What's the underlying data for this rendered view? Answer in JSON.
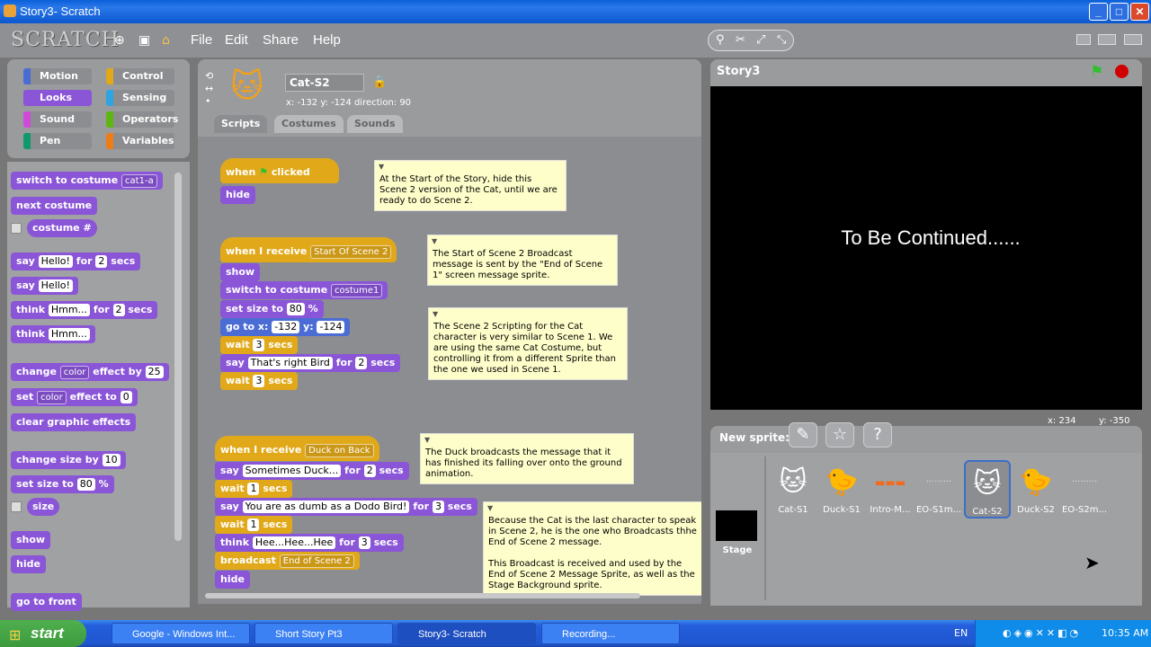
{
  "window": {
    "title": "Story3- Scratch",
    "min": "_",
    "max": "□",
    "close": "✕"
  },
  "menu": {
    "logo": "SCRATCH",
    "items": [
      "File",
      "Edit",
      "Share",
      "Help"
    ]
  },
  "categories": [
    {
      "label": "Motion",
      "color": "#4a6cd4"
    },
    {
      "label": "Control",
      "color": "#e1a91a"
    },
    {
      "label": "Looks",
      "color": "#8a55d7"
    },
    {
      "label": "Sensing",
      "color": "#2ca5e2"
    },
    {
      "label": "Sound",
      "color": "#cf4ad9"
    },
    {
      "label": "Operators",
      "color": "#5cb712"
    },
    {
      "label": "Pen",
      "color": "#0e9a6c"
    },
    {
      "label": "Variables",
      "color": "#ee7d16"
    }
  ],
  "palette": {
    "switch": "switch to costume",
    "switch_dd": "cat1-a",
    "next": "next costume",
    "costume_num": "costume #",
    "say_for": "say",
    "say_for_val": "Hello!",
    "for": "for",
    "secs": "secs",
    "say_for_secs": "2",
    "say": "say",
    "say_val": "Hello!",
    "think_for": "think",
    "think_for_val": "Hmm...",
    "think_for_secs": "2",
    "think": "think",
    "think_val": "Hmm...",
    "change_effect": "change",
    "effect_dd": "color",
    "effect_by": "effect by",
    "effect_by_val": "25",
    "set_effect": "set",
    "effect_to": "effect to",
    "effect_to_val": "0",
    "clear": "clear graphic effects",
    "change_size": "change size by",
    "change_size_val": "10",
    "set_size": "set size to",
    "set_size_val": "80",
    "pct": "%",
    "size": "size",
    "show": "show",
    "hide": "hide",
    "front": "go to front"
  },
  "sprite": {
    "name": "Cat-S2",
    "coords": "x: -132  y: -124  direction: 90",
    "tabs": [
      "Scripts",
      "Costumes",
      "Sounds"
    ]
  },
  "script1": {
    "when": "when",
    "clicked": "clicked",
    "hide": "hide"
  },
  "script2": {
    "receive": "when I receive",
    "msg": "Start Of Scene 2",
    "show": "show",
    "switch": "switch to costume",
    "costume": "costume1",
    "setsize": "set size to",
    "size": "80",
    "pct": "%",
    "goto": "go to x:",
    "x": "-132",
    "y_label": "y:",
    "y": "-124",
    "wait": "wait",
    "wait1": "3",
    "secs": "secs",
    "say": "say",
    "say_val": "That's right Bird",
    "for": "for",
    "say_secs": "2",
    "wait2": "3"
  },
  "script3": {
    "receive": "when I receive",
    "msg": "Duck on Back",
    "say": "say",
    "s1": "Sometimes Duck...",
    "for": "for",
    "s1n": "2",
    "secs": "secs",
    "wait": "wait",
    "w1": "1",
    "s2": "You are as dumb as a Dodo Bird!",
    "s2n": "3",
    "w2": "1",
    "think": "think",
    "t1": "Hee...Hee...Hee",
    "t1n": "3",
    "broadcast": "broadcast",
    "bmsg": "End of Scene 2",
    "hide": "hide"
  },
  "notes": [
    "At the Start of the Story, hide this Scene 2 version of the Cat, until we are ready to do Scene 2.",
    "The Start of Scene 2 Broadcast message is sent by the \"End of Scene 1\" screen message sprite.",
    "The Scene 2 Scripting for the Cat character is very similar to Scene 1. We are using the same Cat Costume, but controlling it from a different Sprite than the one we used in Scene 1.",
    "The Duck broadcasts the message that it has finished its falling over onto the ground animation.",
    "Because the Cat is the last character to speak in Scene 2, he is the one who Broadcasts thhe End of Scene 2 message.\n\nThis Broadcast is received and used by the End of Scene 2 Message Sprite, as well as the Stage Background sprite."
  ],
  "stage": {
    "title": "Story3",
    "text": "To Be Continued......",
    "mouse_x": "x: 234",
    "mouse_y": "y: -350"
  },
  "sprites_panel": {
    "new_sprite": "New sprite:",
    "stage_label": "Stage",
    "sprites": [
      "Cat-S1",
      "Duck-S1",
      "Intro-M...",
      "EO-S1m...",
      "Cat-S2",
      "Duck-S2",
      "EO-S2m..."
    ]
  },
  "taskbar": {
    "start": "start",
    "tasks": [
      "Google - Windows Int...",
      "Short Story Pt3",
      "Story3- Scratch",
      "Recording..."
    ],
    "lang": "EN",
    "time": "10:35 AM"
  }
}
